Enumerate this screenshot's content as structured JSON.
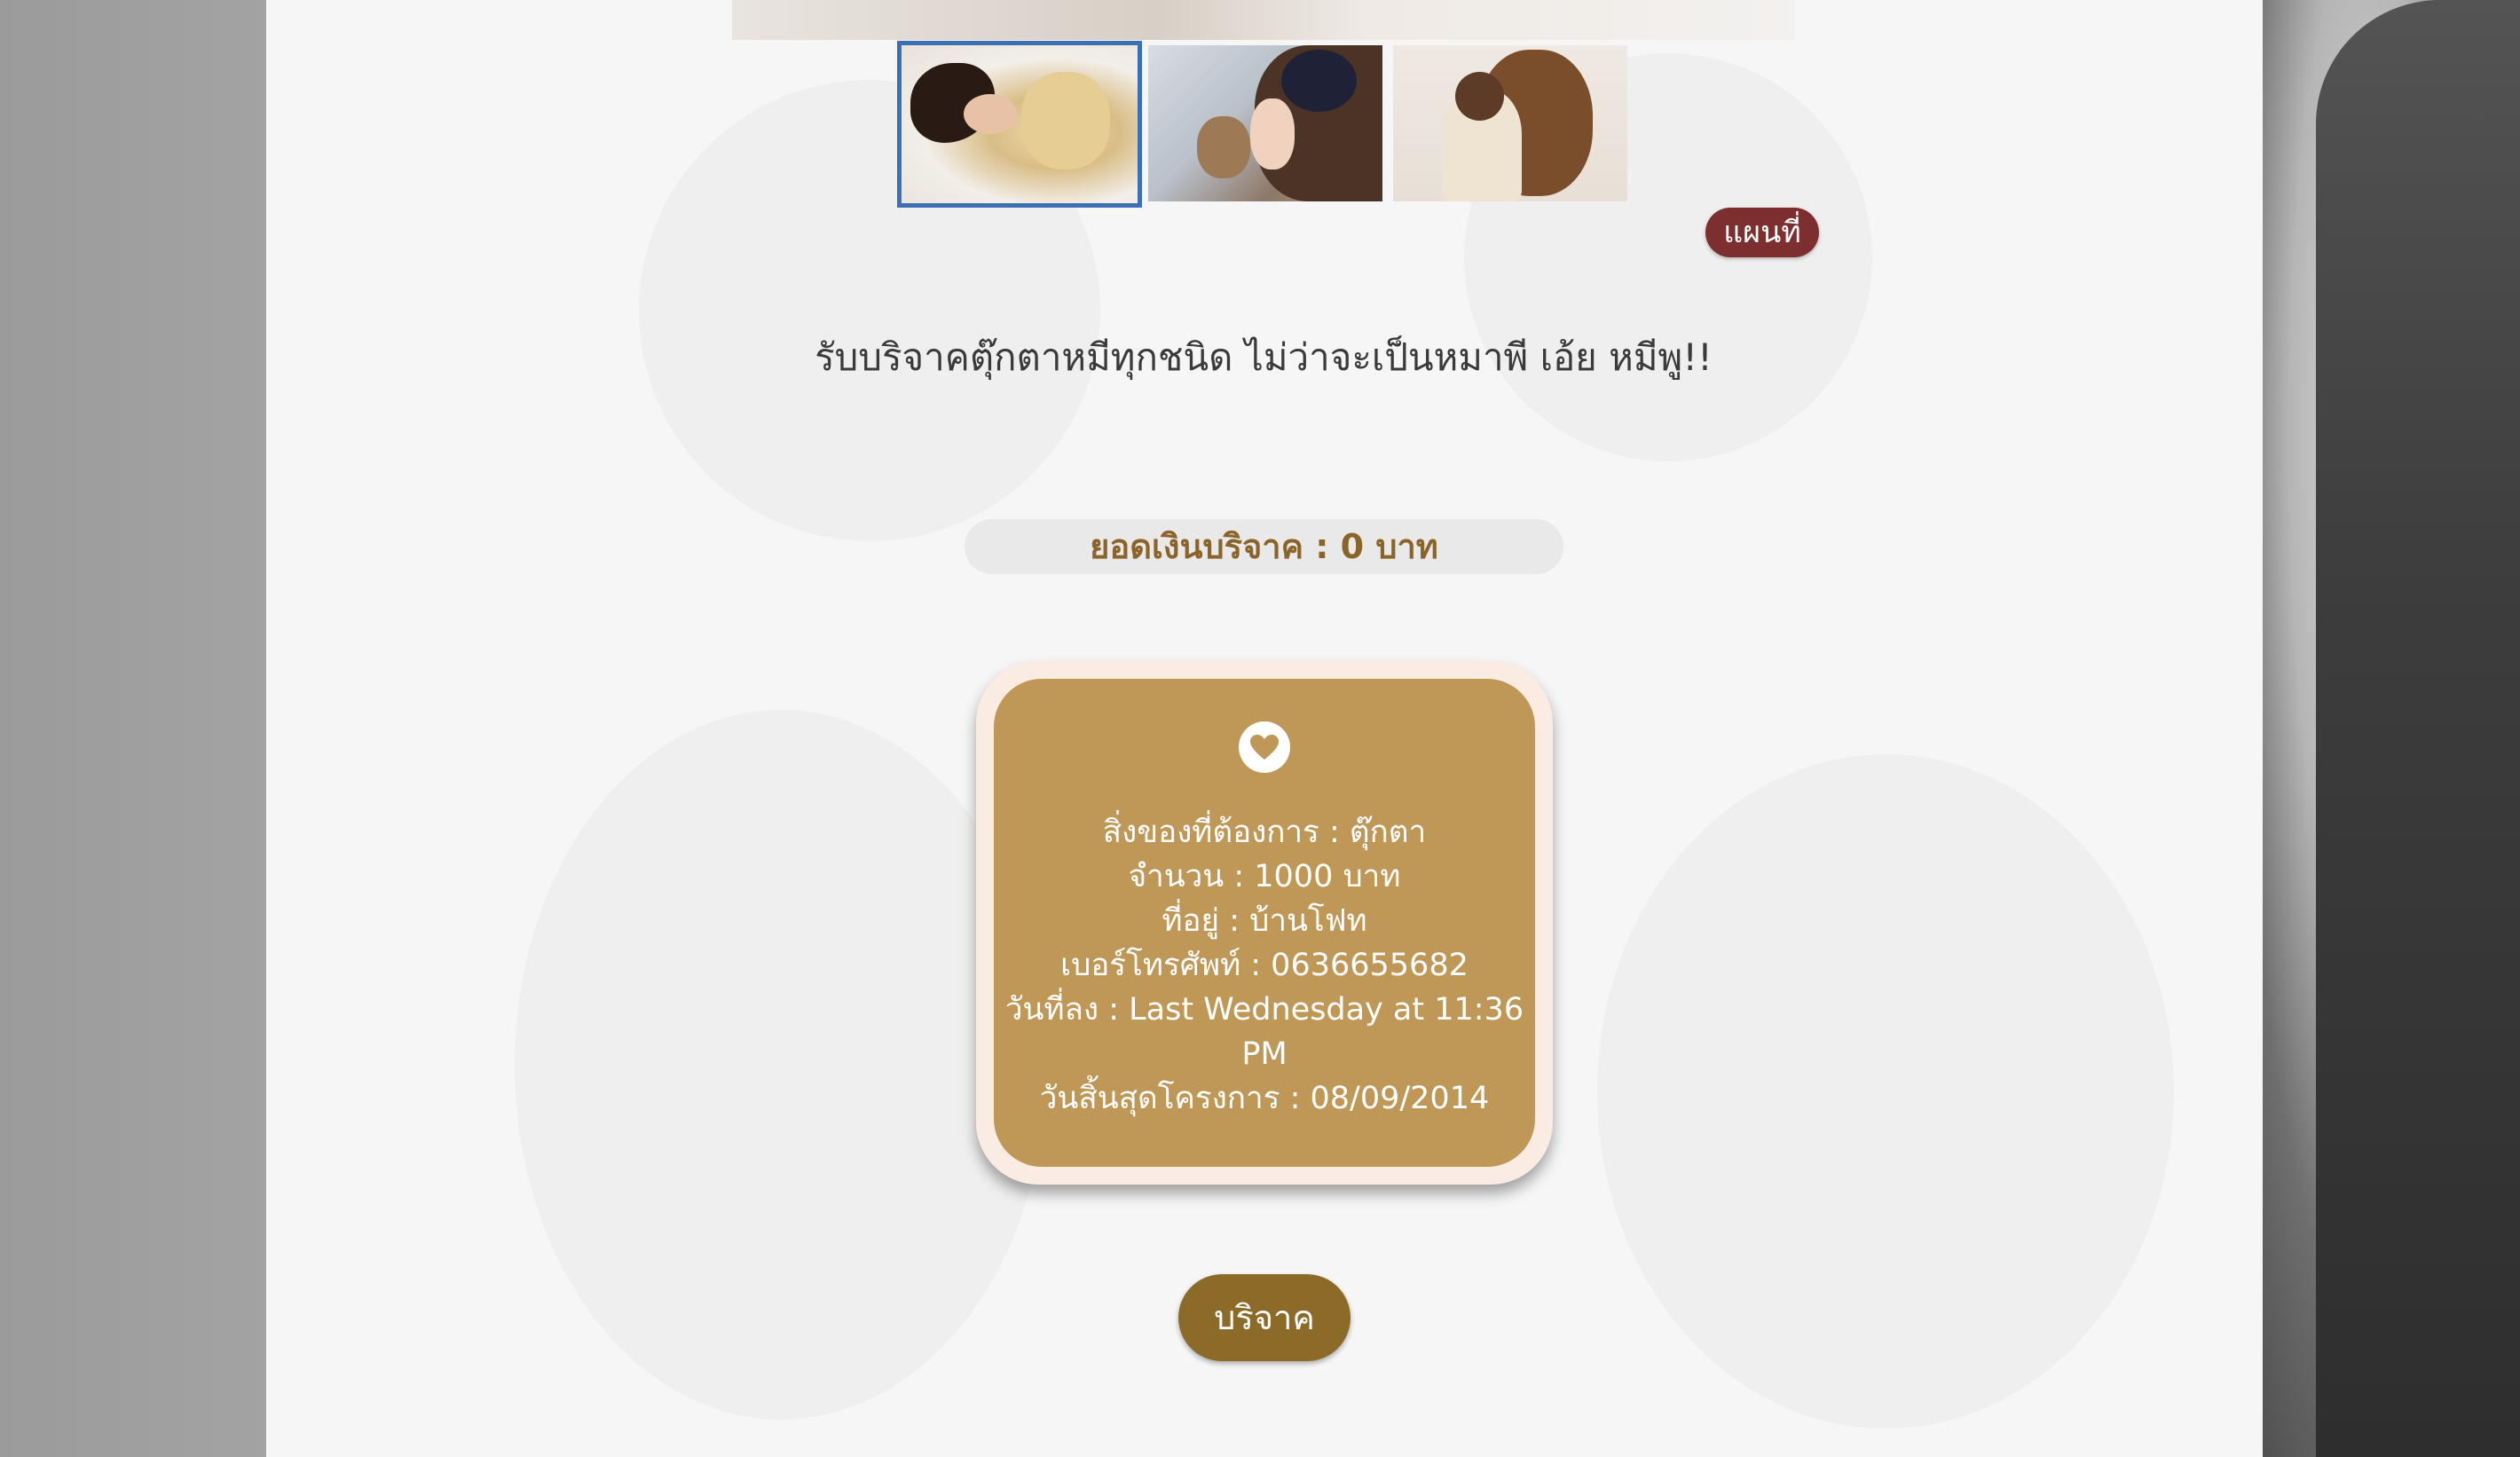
{
  "gallery": {
    "thumbnails": [
      {
        "alt": "girl-sleeping-with-teddy-bear",
        "selected": true
      },
      {
        "alt": "girl-kissing-teddy-bear",
        "selected": false
      },
      {
        "alt": "child-hugging-large-teddy-bear",
        "selected": false
      }
    ]
  },
  "map_button": {
    "label": "แผนที่"
  },
  "headline": "รับบริจาคตุ๊กตาหมีทุกชนิด ไม่ว่าจะเป็นหมาพี เอ้ย หมีพู!!",
  "donation_total": {
    "text": "ยอดเงินบริจาค : 0 บาท"
  },
  "detail_card": {
    "icon": "heart-icon",
    "lines": [
      "สิ่งของที่ต้องการ : ตุ๊กตา",
      "จำนวน : 1000 บาท",
      "ที่อยู่ : บ้านโฟท",
      "เบอร์โทรศัพท์ : 0636655682",
      "วันที่ลง : Last Wednesday at 11:36 PM",
      "วันสิ้นสุดโครงการ : 08/09/2014"
    ]
  },
  "donate_button": {
    "label": "บริจาค"
  },
  "colors": {
    "card_gold": "#bf9858",
    "card_border": "#fbece3",
    "button_brown": "#8c6b28",
    "map_button_red": "#7d2f2f",
    "total_text": "#8b6429",
    "thumb_selected_border": "#3d6fb4"
  }
}
